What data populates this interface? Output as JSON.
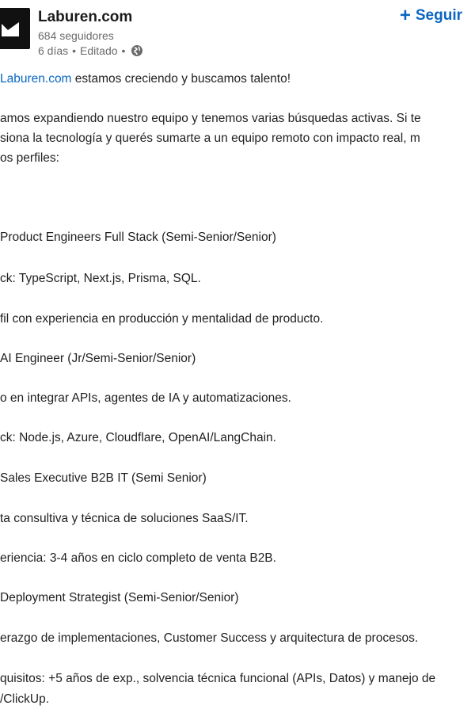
{
  "header": {
    "company_name": "Laburen.com",
    "followers": "684 seguidores",
    "time": "6 días",
    "edited": "Editado",
    "separator": "•",
    "visibility_icon": "globe-icon",
    "follow_label": "Seguir",
    "follow_icon": "plus-icon"
  },
  "colors": {
    "link": "#0a66c2",
    "text": "#1f1f1f",
    "muted": "#6b6b6b",
    "logo_bg": "#111111"
  },
  "post": {
    "intro_link": "Laburen.com",
    "intro_rest": " estamos creciendo y buscamos talento!",
    "lines": [
      "amos expandiendo nuestro equipo y tenemos varias búsquedas activas. Si te",
      "siona la tecnología y querés sumarte a un equipo remoto con impacto real, m",
      "os perfiles:",
      "Product Engineers Full Stack (Semi-Senior/Senior)",
      "ck: TypeScript, Next.js, Prisma, SQL.",
      "fil con experiencia en producción y mentalidad de producto.",
      "AI Engineer (Jr/Semi-Senior/Senior)",
      "o en integrar APIs, agentes de IA y automatizaciones.",
      "ck: Node.js, Azure, Cloudflare, OpenAI/LangChain.",
      "Sales Executive B2B IT (Semi Senior)",
      "ta consultiva y técnica de soluciones SaaS/IT.",
      "eriencia: 3-4 años en ciclo completo de venta B2B.",
      "Deployment Strategist (Semi-Senior/Senior)",
      "erazgo de implementaciones, Customer Success y arquitectura de procesos.",
      "quisitos: +5 años de exp., solvencia técnica funcional (APIs, Datos) y manejo de",
      "/ClickUp."
    ]
  }
}
